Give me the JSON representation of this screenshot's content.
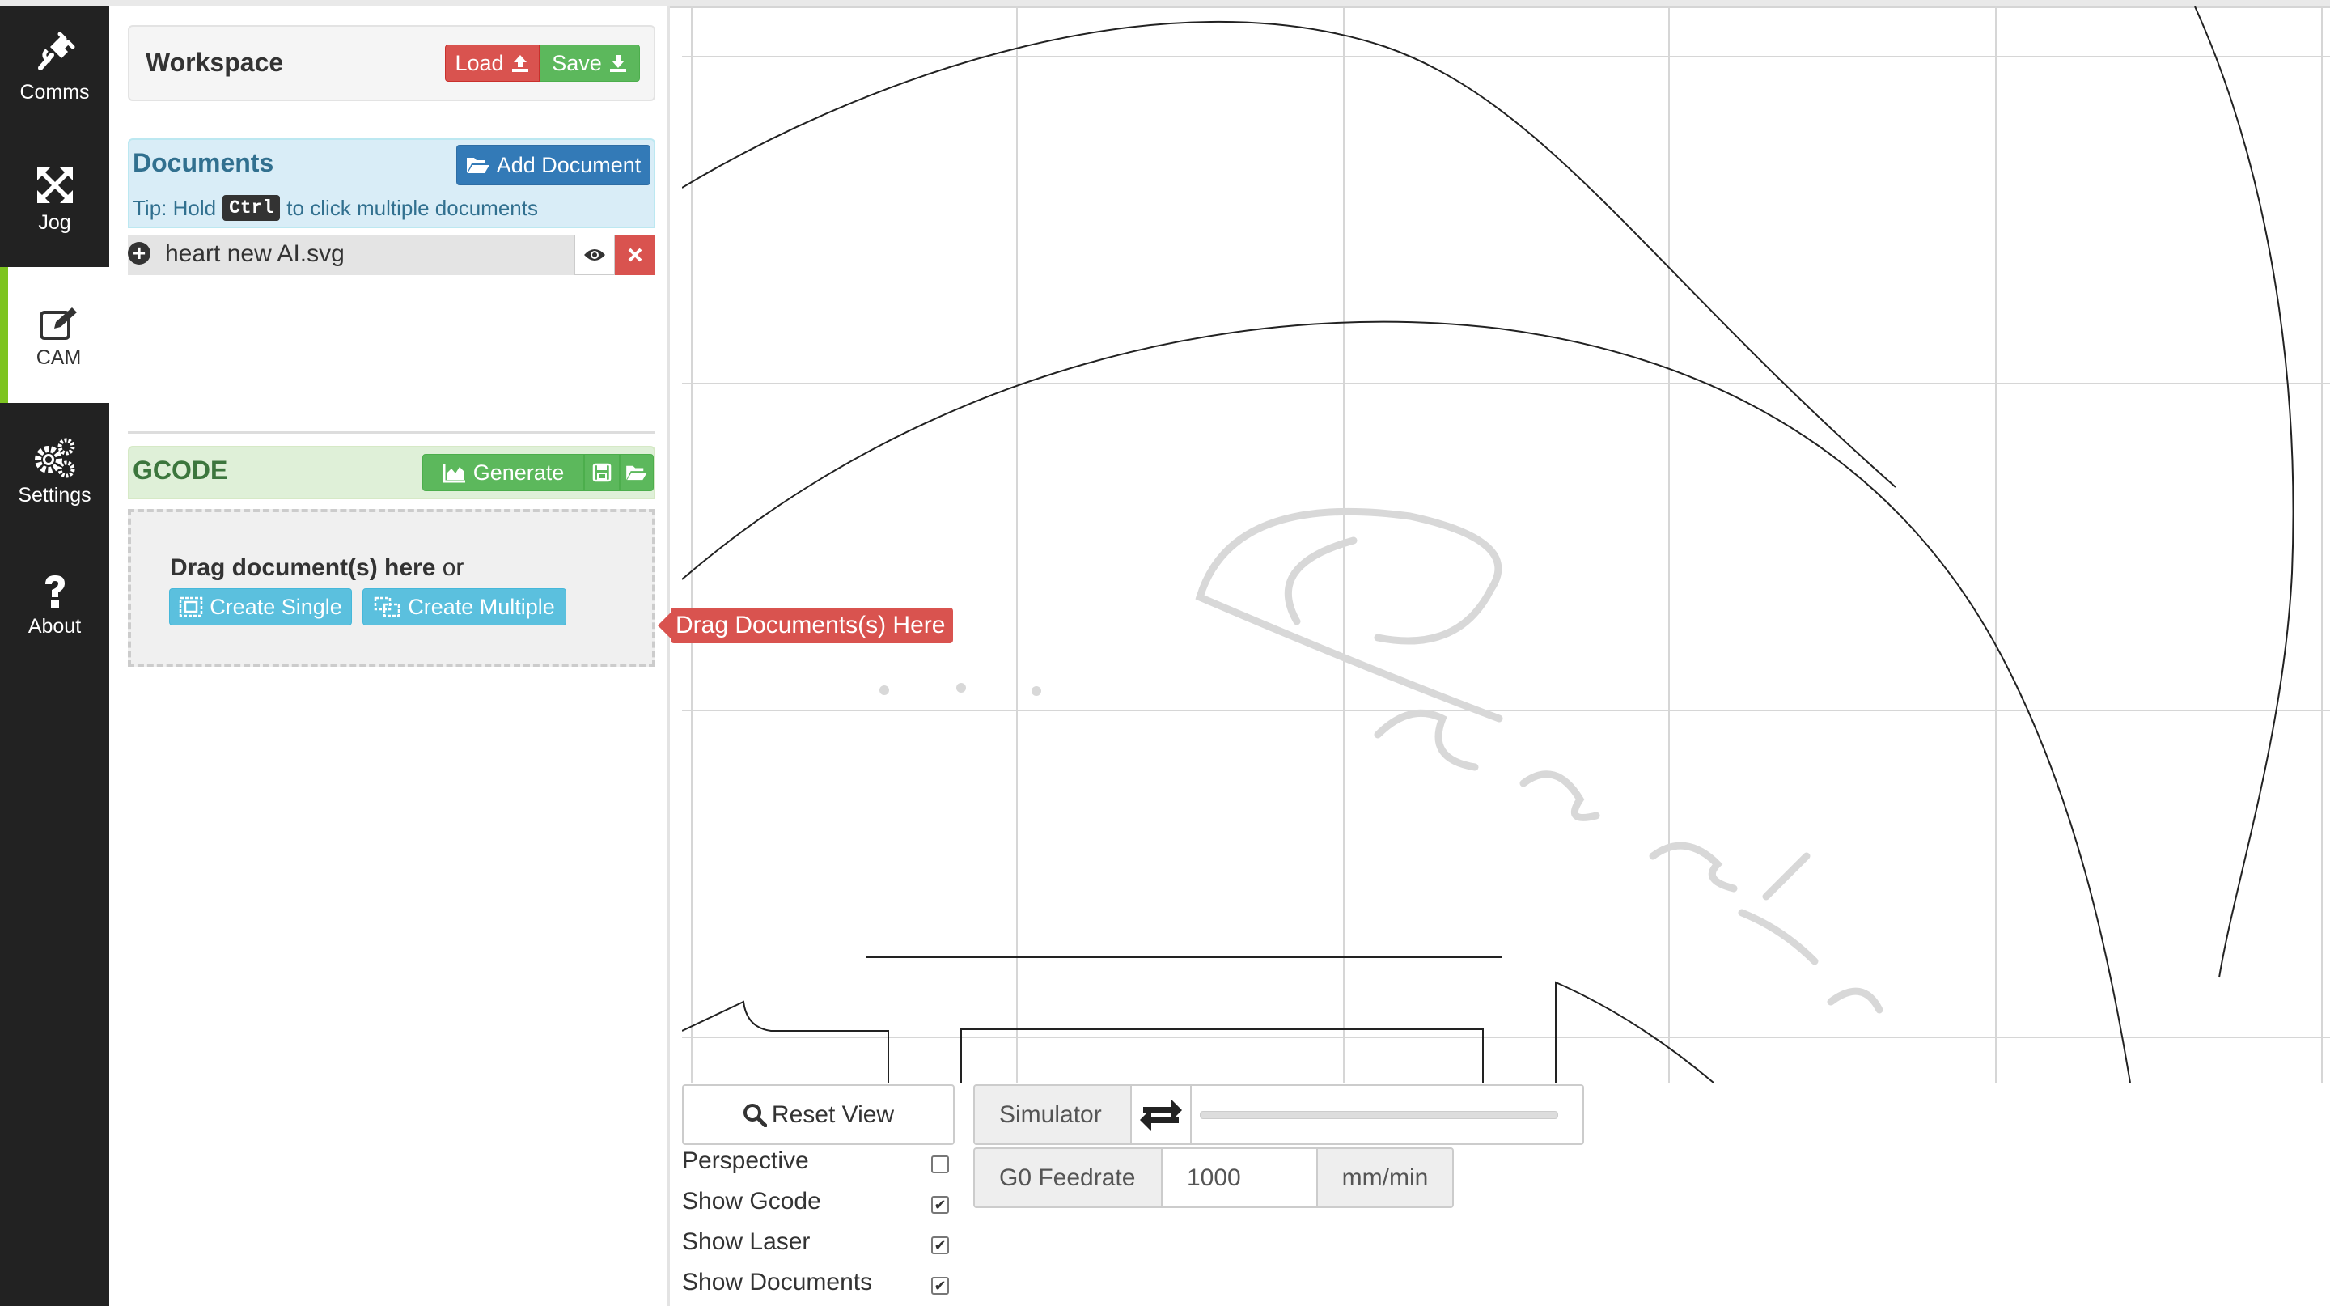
{
  "sidebar": {
    "items": [
      {
        "label": "Comms",
        "icon": "plug-icon"
      },
      {
        "label": "Jog",
        "icon": "arrows-icon"
      },
      {
        "label": "CAM",
        "icon": "edit-icon"
      },
      {
        "label": "Settings",
        "icon": "gears-icon"
      },
      {
        "label": "About",
        "icon": "question-icon"
      }
    ],
    "active": "CAM"
  },
  "workspace": {
    "title": "Workspace",
    "load_label": "Load",
    "save_label": "Save"
  },
  "documents": {
    "title": "Documents",
    "add_label": "Add Document",
    "tip_before": "Tip: Hold",
    "tip_key": "Ctrl",
    "tip_after": "to click multiple documents",
    "items": [
      {
        "name": "heart new AI.svg"
      }
    ]
  },
  "gcode": {
    "title": "GCODE",
    "generate_label": "Generate",
    "drop_bold": "Drag document(s) here",
    "drop_or": "or",
    "create_single": "Create Single",
    "create_multiple": "Create Multiple"
  },
  "tooltip": "Drag Documents(s) Here",
  "viewer": {
    "reset_view": "Reset View",
    "simulator_label": "Simulator",
    "feedrate_label": "G0 Feedrate",
    "feedrate_value": "1000",
    "feedrate_unit": "mm/min",
    "options": [
      {
        "label": "Perspective",
        "checked": false
      },
      {
        "label": "Show Gcode",
        "checked": true
      },
      {
        "label": "Show Laser",
        "checked": true
      },
      {
        "label": "Show Documents",
        "checked": true
      }
    ]
  },
  "colors": {
    "sidebar": "#222222",
    "active_accent": "#7dc420",
    "danger": "#d9534f",
    "success": "#5cb85c",
    "primary": "#337ab7",
    "info": "#5bc0de"
  }
}
